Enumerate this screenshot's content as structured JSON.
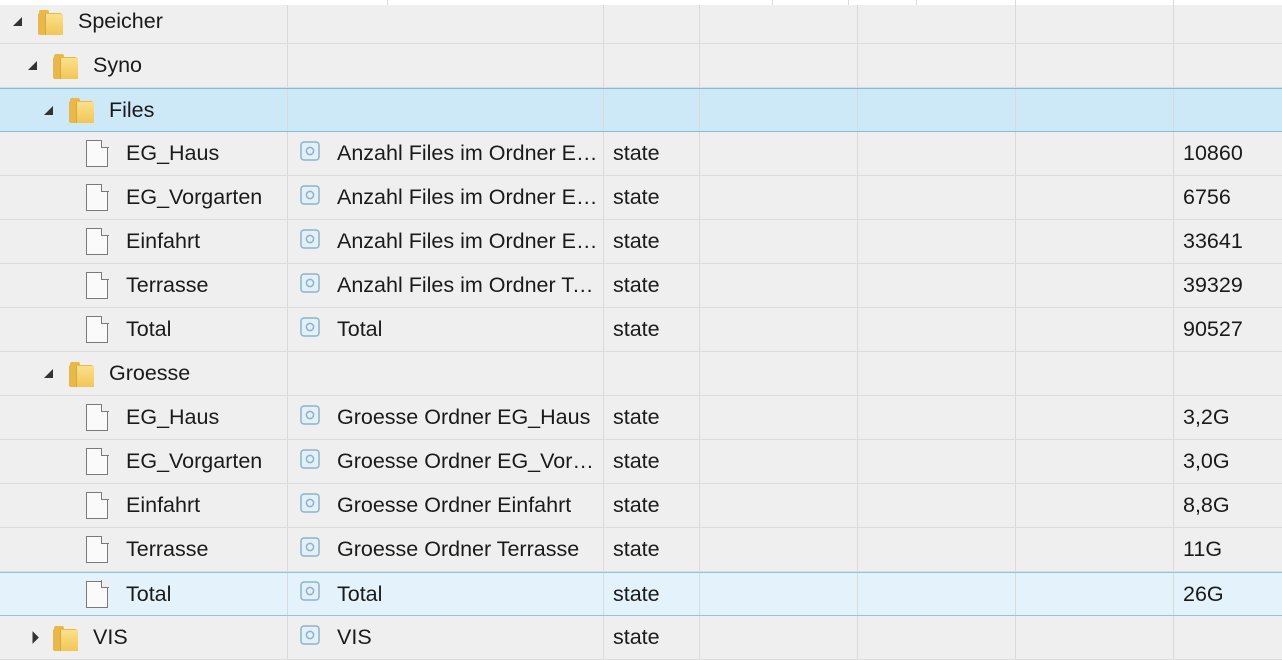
{
  "tree": [
    {
      "name": "Speicher",
      "kind": "folder",
      "level": 0,
      "expanded": true
    },
    {
      "name": "Syno",
      "kind": "folder",
      "level": 1,
      "expanded": true
    },
    {
      "name": "Files",
      "kind": "folder",
      "level": 2,
      "expanded": true,
      "selected": "strong"
    },
    {
      "name": "EG_Haus",
      "kind": "state",
      "level": 3,
      "description": "Anzahl Files im Ordner EG_Haus",
      "role": "state",
      "value": "10860"
    },
    {
      "name": "EG_Vorgarten",
      "kind": "state",
      "level": 3,
      "description": "Anzahl Files im Ordner EG_Vorgarten",
      "role": "state",
      "value": "6756"
    },
    {
      "name": "Einfahrt",
      "kind": "state",
      "level": 3,
      "description": "Anzahl Files im Ordner Einfahrt",
      "role": "state",
      "value": "33641"
    },
    {
      "name": "Terrasse",
      "kind": "state",
      "level": 3,
      "description": "Anzahl Files im Ordner Terrasse",
      "role": "state",
      "value": "39329"
    },
    {
      "name": "Total",
      "kind": "state",
      "level": 3,
      "description": "Total",
      "role": "state",
      "value": "90527"
    },
    {
      "name": "Groesse",
      "kind": "folder",
      "level": 2,
      "expanded": true
    },
    {
      "name": "EG_Haus",
      "kind": "state",
      "level": 3,
      "description": "Groesse Ordner EG_Haus",
      "role": "state",
      "value": "3,2G"
    },
    {
      "name": "EG_Vorgarten",
      "kind": "state",
      "level": 3,
      "description": "Groesse Ordner EG_Vorgarten",
      "role": "state",
      "value": "3,0G"
    },
    {
      "name": "Einfahrt",
      "kind": "state",
      "level": 3,
      "description": "Groesse Ordner Einfahrt",
      "role": "state",
      "value": "8,8G"
    },
    {
      "name": "Terrasse",
      "kind": "state",
      "level": 3,
      "description": "Groesse Ordner Terrasse",
      "role": "state",
      "value": "11G"
    },
    {
      "name": "Total",
      "kind": "state",
      "level": 3,
      "description": "Total",
      "role": "state",
      "value": "26G",
      "selected": "light"
    },
    {
      "name": "VIS",
      "kind": "folder",
      "level": 1,
      "expanded": false,
      "description": "VIS",
      "role": "state",
      "value": ""
    }
  ],
  "colors": {
    "selected_strong": "#cde8f6",
    "selected_light": "#e4f2fb",
    "folder": "#f2c658",
    "grid_line": "#dadada"
  }
}
